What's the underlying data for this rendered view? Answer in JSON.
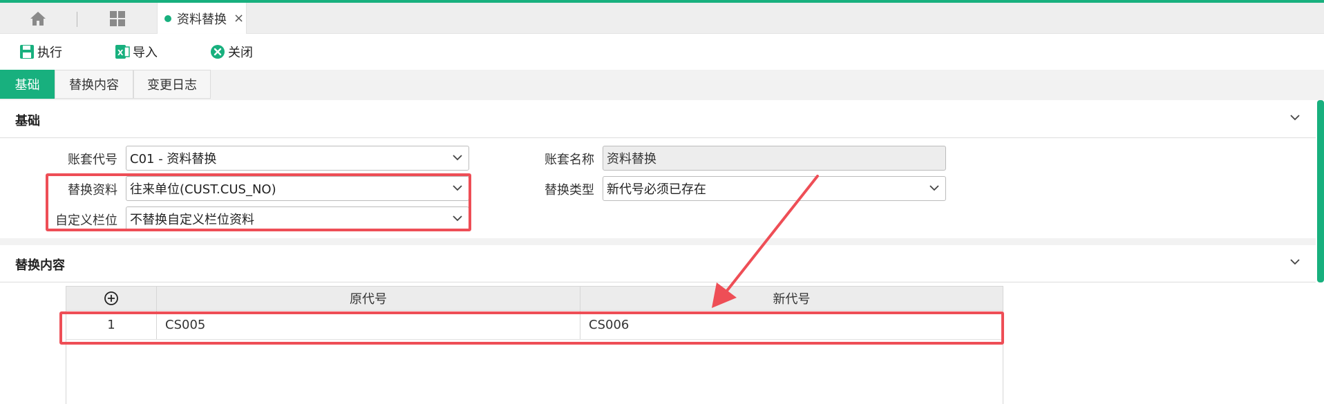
{
  "tabbar": {
    "home_icon": "home-icon",
    "apps_icon": "grid-icon",
    "doc_tab": {
      "label": "资料替换",
      "close": "×"
    }
  },
  "toolbar": {
    "execute": "执行",
    "import": "导入",
    "close": "关闭"
  },
  "form_tabs": [
    "基础",
    "替换内容",
    "变更日志"
  ],
  "basic_section": {
    "title": "基础",
    "fields": {
      "account_code": {
        "label": "账套代号",
        "value": "C01 - 资料替换"
      },
      "account_name": {
        "label": "账套名称",
        "value": "资料替换"
      },
      "replace_data": {
        "label": "替换资料",
        "value": "往来单位(CUST.CUS_NO)"
      },
      "replace_type": {
        "label": "替换类型",
        "value": "新代号必须已存在"
      },
      "custom_field": {
        "label": "自定义栏位",
        "value": "不替换自定义栏位资料"
      }
    }
  },
  "content_section": {
    "title": "替换内容",
    "add_icon": "⊕",
    "columns": [
      "原代号",
      "新代号"
    ],
    "rows": [
      {
        "index": "1",
        "old_code": "CS005",
        "new_code": "CS006"
      }
    ]
  },
  "colors": {
    "accent": "#18b07e",
    "highlight": "#ee4e56"
  }
}
